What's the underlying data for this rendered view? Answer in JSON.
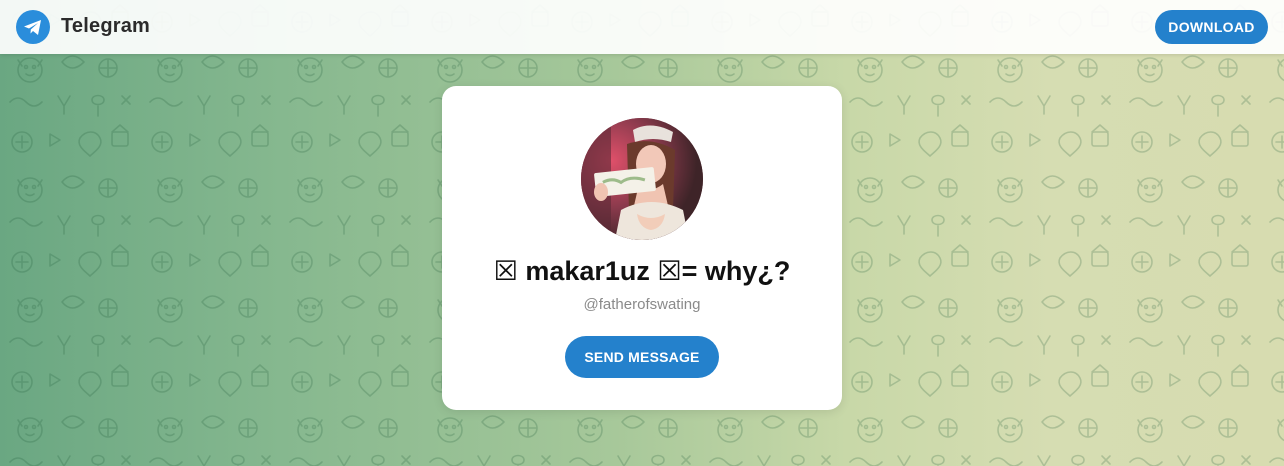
{
  "header": {
    "brand": "Telegram",
    "download_label": "DOWNLOAD"
  },
  "profile": {
    "name": "☒ makar1uz ☒= why¿?",
    "username": "@fatherofswating",
    "send_label": "SEND MESSAGE"
  },
  "colors": {
    "accent": "#2481cc",
    "logo": "#2a8ddb",
    "bg_left": "#6aa782",
    "bg_right": "#d7dcb0"
  },
  "icons": {
    "logo": "telegram-plane-icon",
    "avatar": "profile-photo",
    "background": "doodle-pattern"
  }
}
